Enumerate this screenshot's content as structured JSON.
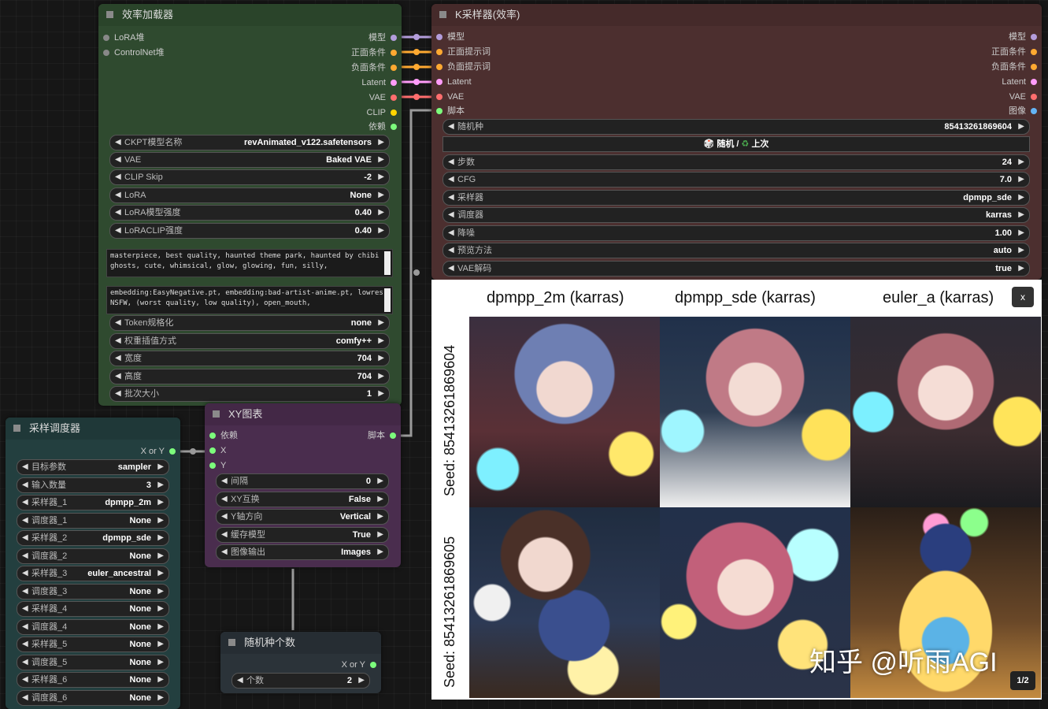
{
  "efficiency_loader": {
    "title": "效率加载器",
    "inputs": [
      "LoRA堆",
      "ControlNet堆"
    ],
    "outputs": [
      "模型",
      "正面条件",
      "负面条件",
      "Latent",
      "VAE",
      "CLIP",
      "依赖"
    ],
    "widgets": [
      {
        "label": "CKPT模型名称",
        "value": "revAnimated_v122.safetensors"
      },
      {
        "label": "VAE",
        "value": "Baked VAE"
      },
      {
        "label": "CLIP Skip",
        "value": "-2"
      },
      {
        "label": "LoRA",
        "value": "None"
      },
      {
        "label": "LoRA模型强度",
        "value": "0.40"
      },
      {
        "label": "LoRACLIP强度",
        "value": "0.40"
      }
    ],
    "positive_prompt": "masterpiece, best quality, haunted theme park, haunted by chibi ghosts, cute, whimsical, glow, glowing, fun, silly,",
    "negative_prompt": "embedding:EasyNegative.pt, embedding:bad-artist-anime.pt, lowres, NSFW, (worst quality, low quality), open_mouth,",
    "widgets2": [
      {
        "label": "Token规格化",
        "value": "none"
      },
      {
        "label": "权重插值方式",
        "value": "comfy++"
      },
      {
        "label": "宽度",
        "value": "704"
      },
      {
        "label": "高度",
        "value": "704"
      },
      {
        "label": "批次大小",
        "value": "1"
      }
    ]
  },
  "ksampler": {
    "title": "K采样器(效率)",
    "inputs": [
      "模型",
      "正面提示词",
      "负面提示词",
      "Latent",
      "VAE",
      "脚本"
    ],
    "outputs": [
      "模型",
      "正面条件",
      "负面条件",
      "Latent",
      "VAE",
      "图像"
    ],
    "seed": {
      "label": "随机种",
      "value": "85413261869604"
    },
    "seed_button": {
      "dice": "🎲",
      "text1": "随机",
      "sep": " / ",
      "recycle": "♻",
      "text2": "上次"
    },
    "widgets": [
      {
        "label": "步数",
        "value": "24"
      },
      {
        "label": "CFG",
        "value": "7.0"
      },
      {
        "label": "采样器",
        "value": "dpmpp_sde"
      },
      {
        "label": "调度器",
        "value": "karras"
      },
      {
        "label": "降噪",
        "value": "1.00"
      },
      {
        "label": "预览方法",
        "value": "auto"
      },
      {
        "label": "VAE解码",
        "value": "true"
      }
    ]
  },
  "sampler_scheduler": {
    "title": "采样调度器",
    "output": "X or Y",
    "widgets": [
      {
        "label": "目标参数",
        "value": "sampler"
      },
      {
        "label": "输入数量",
        "value": "3"
      },
      {
        "label": "采样器_1",
        "value": "dpmpp_2m"
      },
      {
        "label": "调度器_1",
        "value": "None"
      },
      {
        "label": "采样器_2",
        "value": "dpmpp_sde"
      },
      {
        "label": "调度器_2",
        "value": "None"
      },
      {
        "label": "采样器_3",
        "value": "euler_ancestral"
      },
      {
        "label": "调度器_3",
        "value": "None"
      },
      {
        "label": "采样器_4",
        "value": "None"
      },
      {
        "label": "调度器_4",
        "value": "None"
      },
      {
        "label": "采样器_5",
        "value": "None"
      },
      {
        "label": "调度器_5",
        "value": "None"
      },
      {
        "label": "采样器_6",
        "value": "None"
      },
      {
        "label": "调度器_6",
        "value": "None"
      }
    ]
  },
  "xy_plot": {
    "title": "XY图表",
    "inputs": [
      "依赖",
      "X",
      "Y"
    ],
    "output": "脚本",
    "widgets": [
      {
        "label": "间隔",
        "value": "0"
      },
      {
        "label": "XY互换",
        "value": "False"
      },
      {
        "label": "Y轴方向",
        "value": "Vertical"
      },
      {
        "label": "缓存模型",
        "value": "True"
      },
      {
        "label": "图像输出",
        "value": "Images"
      }
    ]
  },
  "seed_count": {
    "title": "随机种个数",
    "output": "X or Y",
    "widget": {
      "label": "个数",
      "value": "2"
    }
  },
  "preview": {
    "columns": [
      "dpmpp_2m (karras)",
      "dpmpp_sde (karras)",
      "euler_a (karras)"
    ],
    "rows": [
      "Seed: 85413261869604",
      "Seed: 85413261869605"
    ],
    "close": "x",
    "pager": "1/2",
    "watermark": "知乎 @听雨AGI"
  },
  "colors": {
    "loader_bg": "#2f4a2f",
    "ksampler_bg": "#4c2f2f",
    "scheduler_bg": "#233f3f",
    "xy_bg": "#4a2d4e",
    "seedcount_bg": "#2b3339",
    "wire_model": "#b39ddb",
    "wire_cond": "#ffa931",
    "wire_latent": "#ff9cf9",
    "wire_vae": "#ff6e6e",
    "wire_clip": "#ffd500",
    "wire_gray": "#9a9a9a"
  }
}
